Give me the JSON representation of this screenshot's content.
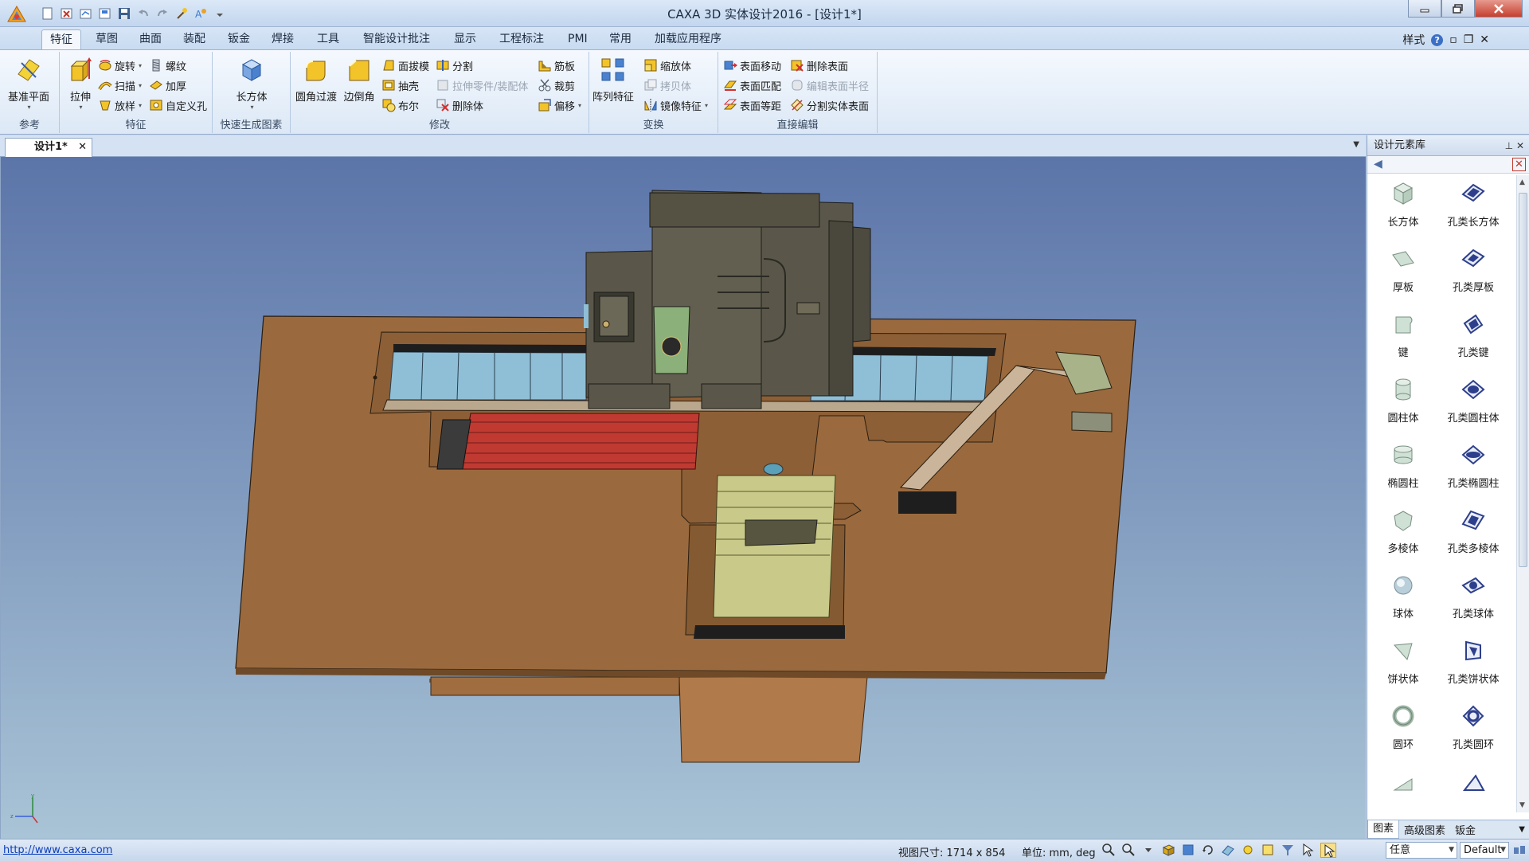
{
  "window": {
    "title": "CAXA 3D 实体设计2016 - [设计1*]"
  },
  "colors": {
    "accent": "#3b6fc5",
    "ribbon_bg": "#dce8f6",
    "viewport_top": "#5c75a9",
    "viewport_bottom": "#a9c4d6",
    "floor_plate": "#9a6a3e",
    "machine_body": "#5a574a",
    "red_table": "#c03a32",
    "glass": "#8fbfd6",
    "fixture_yellow": "#c9c98a"
  },
  "qat_icons": [
    "new-icon",
    "close-file-icon",
    "open-icon",
    "save-as-icon",
    "save-icon",
    "undo-icon",
    "redo-icon",
    "wand-icon",
    "style-icon"
  ],
  "ribbon": {
    "tabs": [
      "特征",
      "草图",
      "曲面",
      "装配",
      "钣金",
      "焊接",
      "工具",
      "智能设计批注",
      "显示",
      "工程标注",
      "PMI",
      "常用",
      "加载应用程序"
    ],
    "active_tab": "特征",
    "style_label": "样式",
    "groups": {
      "reference": {
        "label": "参考",
        "plane": "基准平面"
      },
      "feature": {
        "label": "特征",
        "extrude": "拉伸",
        "revolve": "旋转",
        "sweep": "扫描",
        "loft": "放样",
        "thread": "螺纹",
        "thicken": "加厚",
        "custom_hole": "自定义孔"
      },
      "quick": {
        "label": "快速生成图素",
        "box": "长方体"
      },
      "modify": {
        "label": "修改",
        "fillet": "圆角过渡",
        "chamfer": "边倒角",
        "draft": "面拔模",
        "shell": "抽壳",
        "boolean": "布尔",
        "split": "分割",
        "stretch_part": "拉伸零件/装配体",
        "delete_body": "删除体",
        "rib": "筋板",
        "trim": "裁剪",
        "offset": "偏移"
      },
      "transform": {
        "label": "变换",
        "pattern": "阵列特征",
        "scale": "缩放体",
        "copy": "拷贝体",
        "mirror": "镜像特征"
      },
      "direct": {
        "label": "直接编辑",
        "move_face": "表面移动",
        "match_face": "表面匹配",
        "equidistant": "表面等距",
        "delete_face": "删除表面",
        "edit_radius": "编辑表面半径",
        "split_face": "分割实体表面"
      }
    }
  },
  "document": {
    "tab_label": "设计1*"
  },
  "library": {
    "title": "设计元素库",
    "items": [
      {
        "label": "长方体",
        "icon": "box-icon"
      },
      {
        "label": "孔类长方体",
        "icon": "box-hole-icon"
      },
      {
        "label": "厚板",
        "icon": "plate-icon"
      },
      {
        "label": "孔类厚板",
        "icon": "plate-hole-icon"
      },
      {
        "label": "键",
        "icon": "key-icon"
      },
      {
        "label": "孔类键",
        "icon": "key-hole-icon"
      },
      {
        "label": "圆柱体",
        "icon": "cylinder-icon"
      },
      {
        "label": "孔类圆柱体",
        "icon": "cylinder-hole-icon"
      },
      {
        "label": "椭圆柱",
        "icon": "elliptic-cylinder-icon"
      },
      {
        "label": "孔类椭圆柱",
        "icon": "elliptic-cylinder-hole-icon"
      },
      {
        "label": "多棱体",
        "icon": "prism-icon"
      },
      {
        "label": "孔类多棱体",
        "icon": "prism-hole-icon"
      },
      {
        "label": "球体",
        "icon": "sphere-icon"
      },
      {
        "label": "孔类球体",
        "icon": "sphere-hole-icon"
      },
      {
        "label": "饼状体",
        "icon": "pie-icon"
      },
      {
        "label": "孔类饼状体",
        "icon": "pie-hole-icon"
      },
      {
        "label": "圆环",
        "icon": "torus-icon"
      },
      {
        "label": "孔类圆环",
        "icon": "torus-hole-icon"
      }
    ],
    "tabs": [
      "图素",
      "高级图素",
      "钣金"
    ],
    "active_tab": "图素"
  },
  "status": {
    "link": "http://www.caxa.com",
    "view_size": "视图尺寸: 1714 x  854",
    "units": "单位: mm, deg",
    "filter": "任意",
    "style": "Default"
  }
}
